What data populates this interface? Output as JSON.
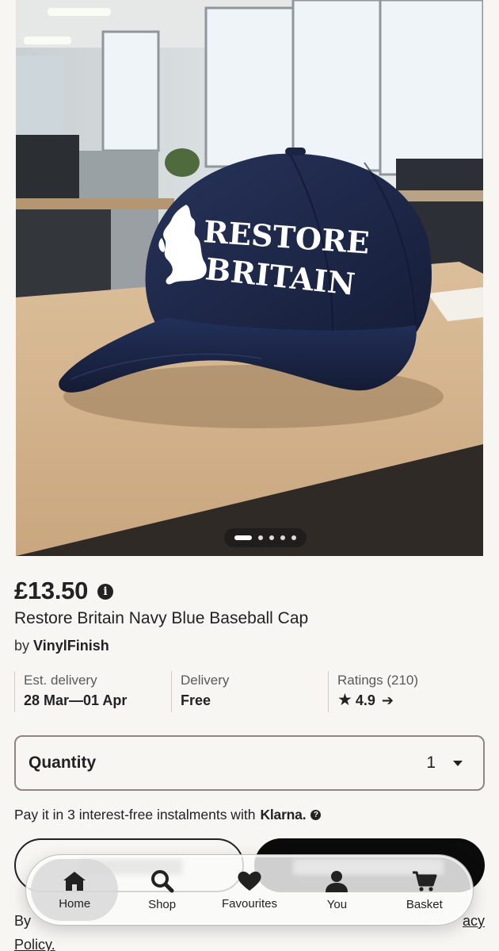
{
  "product": {
    "cap_text_line1": "RESTORE",
    "cap_text_line2": "BRITAIN",
    "gallery_count": 5,
    "gallery_index": 1,
    "price": "£13.50",
    "title": "Restore Britain Navy Blue Baseball Cap",
    "seller_prefix": "by",
    "seller_name": "VinylFinish"
  },
  "stats": {
    "delivery_est_label": "Est. delivery",
    "delivery_est_value": "28 Mar—01 Apr",
    "delivery_label": "Delivery",
    "delivery_value": "Free",
    "ratings_label": "Ratings (210)",
    "ratings_value": "4.9"
  },
  "quantity": {
    "label": "Quantity",
    "value": "1"
  },
  "klarna": {
    "text": "Pay it in 3 interest-free instalments with",
    "logo": "Klarna."
  },
  "footer": {
    "text_start": "By",
    "link_end": "acy",
    "text_line2": "Policy."
  },
  "tabs": [
    {
      "label": "Home",
      "icon": "home-icon",
      "active": true
    },
    {
      "label": "Shop",
      "icon": "search-icon",
      "active": false
    },
    {
      "label": "Favourites",
      "icon": "heart-icon",
      "active": false
    },
    {
      "label": "You",
      "icon": "person-icon",
      "active": false
    },
    {
      "label": "Basket",
      "icon": "cart-icon",
      "active": false
    }
  ],
  "colors": {
    "background": "#f7f6f2",
    "text": "#222222",
    "cap_navy": "#1f2a4d",
    "button_dark": "#0b0b0b"
  }
}
